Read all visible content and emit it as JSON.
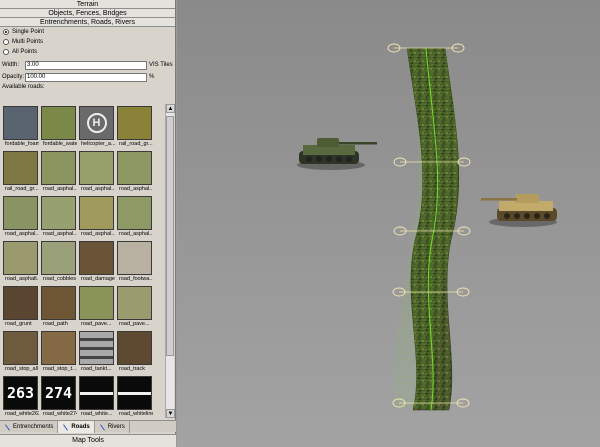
{
  "panel": {
    "sections": [
      "Terrain",
      "Objects, Fences, Bridges",
      "Entrenchments, Roads, Rivers"
    ],
    "mode_options": [
      {
        "label": "Single Point",
        "selected": true
      },
      {
        "label": "Multi Points",
        "selected": false
      },
      {
        "label": "All Points",
        "selected": false
      }
    ],
    "width_label": "Width:",
    "width_value": "3.00",
    "width_unit": "VIS Tiles",
    "opacity_label": "Opacity:",
    "opacity_value": "100.00",
    "opacity_unit": "%",
    "available_label": "Available roads:",
    "roads": [
      {
        "name": "fordable_foam",
        "color": "#5a6470"
      },
      {
        "name": "fordable_water",
        "color": "#7a8848"
      },
      {
        "name": "helicopter_a...",
        "color": "#6a6a6a"
      },
      {
        "name": "rail_road_gr...",
        "color": "#8a8238"
      },
      {
        "name": "rail_road_gr...",
        "color": "#7e7844"
      },
      {
        "name": "road_asphal...",
        "color": "#8c9460"
      },
      {
        "name": "road_asphal...",
        "color": "#98a06a"
      },
      {
        "name": "road_asphal...",
        "color": "#8e9864"
      },
      {
        "name": "road_asphal...",
        "color": "#8a9462"
      },
      {
        "name": "road_asphal...",
        "color": "#96a070"
      },
      {
        "name": "road_asphal...",
        "color": "#a09a5c"
      },
      {
        "name": "road_asphal...",
        "color": "#8e9a66"
      },
      {
        "name": "road_asphalt...",
        "color": "#9a9a6e"
      },
      {
        "name": "road_cobbles",
        "color": "#9aa07a"
      },
      {
        "name": "road_damage",
        "color": "#6a5438"
      },
      {
        "name": "road_footwa...",
        "color": "#b8b0a0"
      },
      {
        "name": "road_grunt",
        "color": "#5a4630"
      },
      {
        "name": "road_path",
        "color": "#6e5634"
      },
      {
        "name": "road_pave...",
        "color": "#8a9458"
      },
      {
        "name": "road_pave...",
        "color": "#9a9c70"
      },
      {
        "name": "road_stop_all",
        "color": "#6e5a3c"
      },
      {
        "name": "road_stop_t...",
        "color": "#846a44"
      },
      {
        "name": "road_tankt...",
        "color": "#a0a0a0"
      },
      {
        "name": "road_track",
        "color": "#5e4a30"
      },
      {
        "name": "road_white263",
        "color": "#0a0a0a"
      },
      {
        "name": "road_white274",
        "color": "#0a0a0a"
      },
      {
        "name": "road_white...",
        "color": "#0a0a0a"
      },
      {
        "name": "road_whiteline",
        "color": "#0a0a0a"
      }
    ],
    "number_tiles": {
      "road_white263": "263",
      "road_white274": "274"
    },
    "tabs": [
      {
        "label": "Entrenchments",
        "active": false
      },
      {
        "label": "Roads",
        "active": true
      },
      {
        "label": "Rivers",
        "active": false
      }
    ],
    "footer": "Map Tools"
  },
  "viewport": {
    "road_color": "#4a5a2a",
    "spline_color": "#6fe02a",
    "handle_color": "#f2e6b0",
    "tank_left_color": "#4b5a34",
    "tank_right_color": "#b8a060"
  }
}
